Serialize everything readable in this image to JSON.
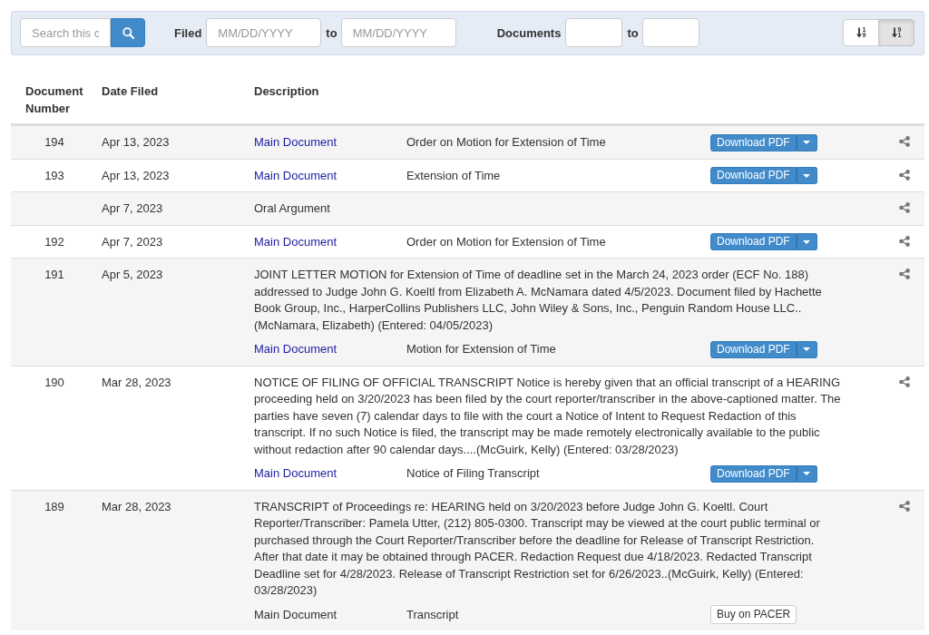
{
  "filters": {
    "search": {
      "placeholder": "Search this c"
    },
    "filed": {
      "label": "Filed",
      "from_placeholder": "MM/DD/YYYY",
      "to_label": "to",
      "to_placeholder": "MM/DD/YYYY"
    },
    "documents": {
      "label": "Documents",
      "to_label": "to"
    },
    "sort_buttons": [
      {
        "digits": [
          "1",
          "9"
        ],
        "selected": false
      },
      {
        "digits": [
          "9",
          "1"
        ],
        "selected": true
      }
    ]
  },
  "table": {
    "columns": [
      "Document Number",
      "Date Filed",
      "Description"
    ],
    "rows": [
      {
        "number": "194",
        "date_filed": "Apr 13, 2023",
        "documents": [
          {
            "label": "Main Document",
            "linked": true,
            "description": "Order on Motion for Extension of Time",
            "action": {
              "kind": "download",
              "label": "Download PDF"
            }
          }
        ]
      },
      {
        "number": "193",
        "date_filed": "Apr 13, 2023",
        "documents": [
          {
            "label": "Main Document",
            "linked": true,
            "description": "Extension of Time",
            "action": {
              "kind": "download",
              "label": "Download PDF"
            }
          }
        ]
      },
      {
        "date_filed": "Apr 7, 2023",
        "description": "Oral Argument"
      },
      {
        "number": "192",
        "date_filed": "Apr 7, 2023",
        "documents": [
          {
            "label": "Main Document",
            "linked": true,
            "description": "Order on Motion for Extension of Time",
            "action": {
              "kind": "download",
              "label": "Download PDF"
            }
          }
        ]
      },
      {
        "number": "191",
        "date_filed": "Apr 5, 2023",
        "description": "JOINT LETTER MOTION for Extension of Time of deadline set in the March 24, 2023 order (ECF No. 188) addressed to Judge John G. Koeltl from Elizabeth A. McNamara dated 4/5/2023. Document filed by Hachette Book Group, Inc., HarperCollins Publishers LLC, John Wiley & Sons, Inc., Penguin Random House LLC..(McNamara, Elizabeth) (Entered: 04/05/2023)",
        "documents": [
          {
            "label": "Main Document",
            "linked": true,
            "description": "Motion for Extension of Time",
            "action": {
              "kind": "download",
              "label": "Download PDF"
            }
          }
        ]
      },
      {
        "number": "190",
        "date_filed": "Mar 28, 2023",
        "description": "NOTICE OF FILING OF OFFICIAL TRANSCRIPT Notice is hereby given that an official transcript of a HEARING proceeding held on 3/20/2023 has been filed by the court reporter/transcriber in the above-captioned matter. The parties have seven (7) calendar days to file with the court a Notice of Intent to Request Redaction of this transcript. If no such Notice is filed, the transcript may be made remotely electronically available to the public without redaction after 90 calendar days....(McGuirk, Kelly) (Entered: 03/28/2023)",
        "documents": [
          {
            "label": "Main Document",
            "linked": true,
            "description": "Notice of Filing Transcript",
            "action": {
              "kind": "download",
              "label": "Download PDF"
            }
          }
        ]
      },
      {
        "number": "189",
        "date_filed": "Mar 28, 2023",
        "description": "TRANSCRIPT of Proceedings re: HEARING held on 3/20/2023 before Judge John G. Koeltl. Court Reporter/Transcriber: Pamela Utter, (212) 805-0300. Transcript may be viewed at the court public terminal or purchased through the Court Reporter/Transcriber before the deadline for Release of Transcript Restriction. After that date it may be obtained through PACER. Redaction Request due 4/18/2023. Redacted Transcript Deadline set for 4/28/2023. Release of Transcript Restriction set for 6/26/2023..(McGuirk, Kelly) (Entered: 03/28/2023)",
        "documents": [
          {
            "label": "Main Document",
            "linked": false,
            "description": "Transcript",
            "action": {
              "kind": "buy",
              "label": "Buy on PACER"
            }
          }
        ]
      }
    ]
  }
}
